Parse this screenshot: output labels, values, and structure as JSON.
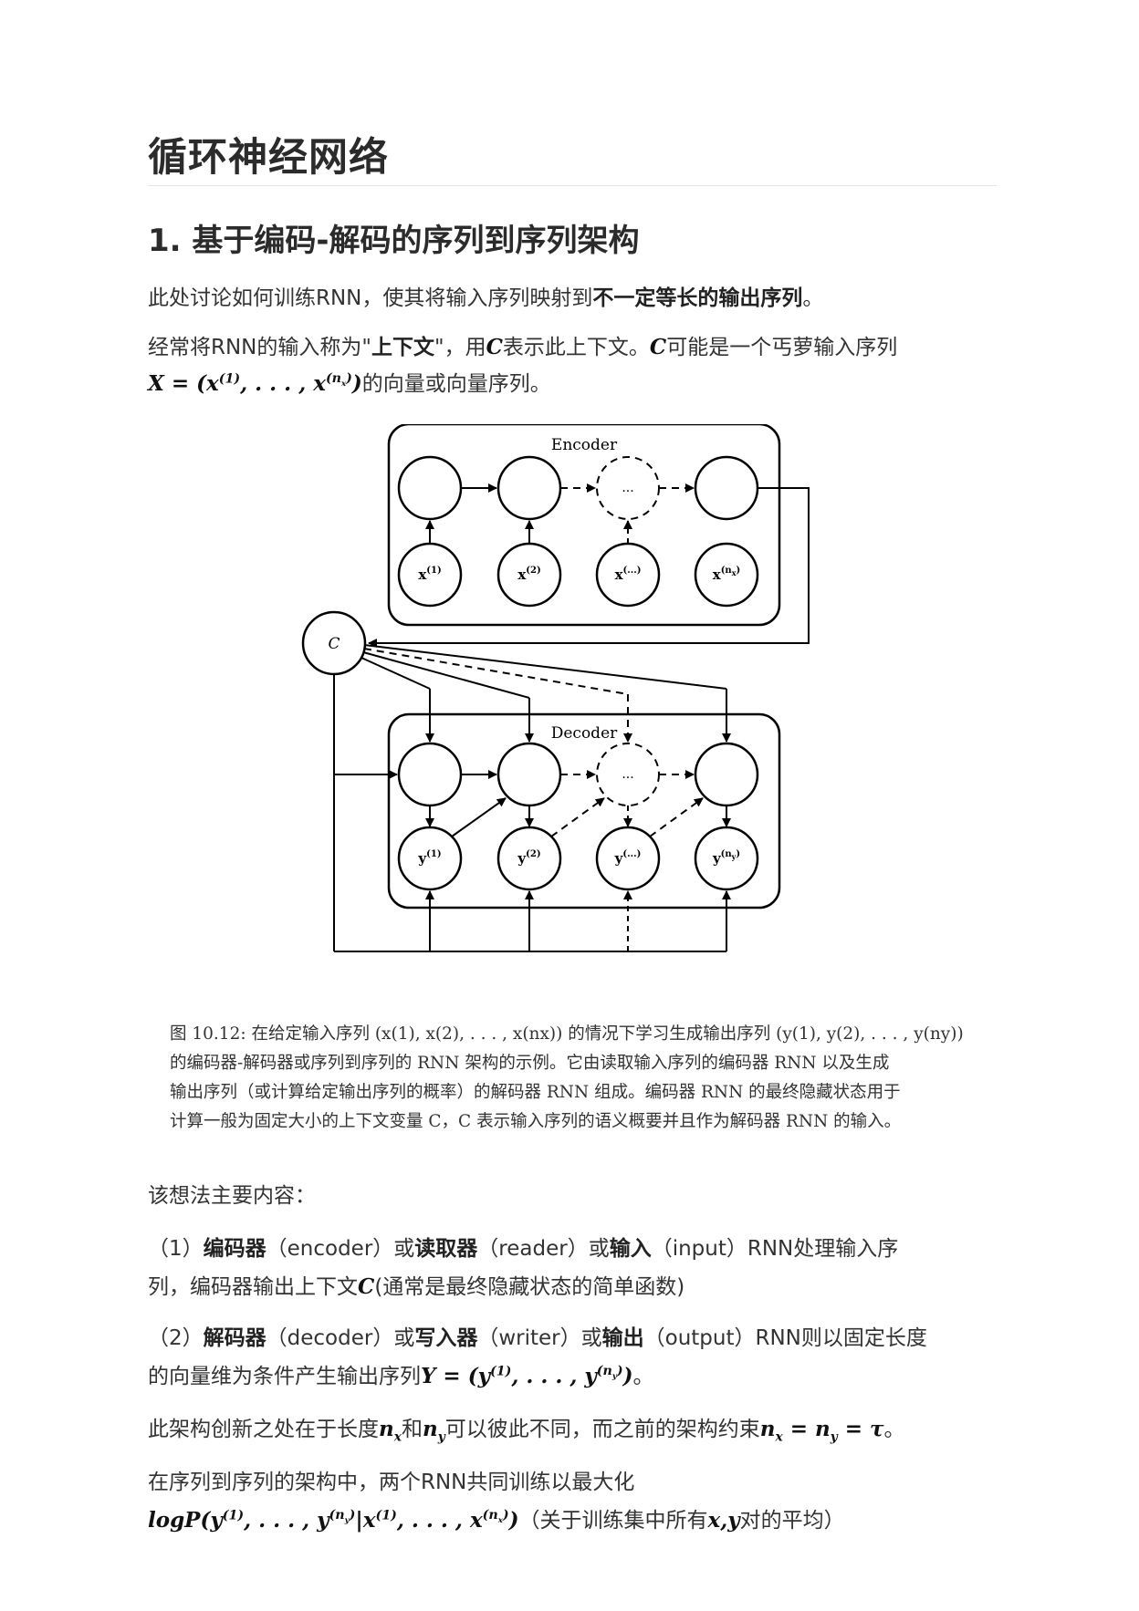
{
  "title": "循环神经网络",
  "section": {
    "heading": "1. 基于编码-解码的序列到序列架构",
    "p1": {
      "before": "此处讨论如何训练RNN，使其将输入序列映射到",
      "bold": "不一定等长的输出序列",
      "after": "。"
    },
    "p2": {
      "a": "经常将RNN的输入称为\"",
      "bold": "上下文",
      "b": "\"，用",
      "c_symbol": "C",
      "c": "表示此上下文。",
      "c_symbol2": "C",
      "d": "可能是一个丐萝输入序列",
      "formula": "X = (x(1), . . . , x(nx))",
      "e": "的向量或向量序列。"
    },
    "figure": {
      "encoder_label": "Encoder",
      "decoder_label": "Decoder",
      "context_label": "C",
      "ellipsis": "...",
      "inputs": [
        "x(1)",
        "x(2)",
        "x(...)",
        "x(nx)"
      ],
      "outputs": [
        "y(1)",
        "y(2)",
        "y(...)",
        "y(ny)"
      ]
    },
    "caption_lines": [
      "图 10.12: 在给定输入序列 (x(1), x(2), . . . , x(nx)) 的情况下学习生成输出序列 (y(1), y(2), . . . , y(ny))",
      "的编码器-解码器或序列到序列的 RNN 架构的示例。它由读取输入序列的编码器 RNN 以及生成",
      "输出序列（或计算给定输出序列的概率）的解码器 RNN 组成。编码器 RNN 的最终隐藏状态用于",
      "计算一般为固定大小的上下文变量 C，C 表示输入序列的语义概要并且作为解码器 RNN 的输入。"
    ],
    "p3": "该想法主要内容：",
    "item1": {
      "a": "（1）",
      "b1": "编码器",
      "t1": "（encoder）或",
      "b2": "读取器",
      "t2": "（reader）或",
      "b3": "输入",
      "t3": "（input）RNN处理输入序",
      "line2a": "列，编码器输出上下文",
      "sym": "C",
      "line2b": "(通常是最终隐藏状态的简单函数)"
    },
    "item2": {
      "a": "（2）",
      "b1": "解码器",
      "t1": "（decoder）或",
      "b2": "写入器",
      "t2": "（writer）或",
      "b3": "输出",
      "t3": "（output）RNN则以固定长度",
      "line2a": "的向量维为条件产生输出序列",
      "formula": "Y = (y(1), . . . , y(ny))",
      "line2b": "。"
    },
    "p4": {
      "a": "此架构创新之处在于长度",
      "nx": "nx",
      "b": "和",
      "ny": "ny",
      "c": "可以彼此不同，而之前的架构约束",
      "eq": "nx = ny = τ",
      "d": "。"
    },
    "p5": {
      "line1": "在序列到序列的架构中，两个RNN共同训练以最大化",
      "formula": "logP(y(1), . . . , y(ny)|x(1), . . . , x(nx))",
      "tail_a": "（关于训练集中所有",
      "x": "x",
      "comma": ",",
      "y": "y",
      "tail_b": "对的平均）"
    }
  }
}
